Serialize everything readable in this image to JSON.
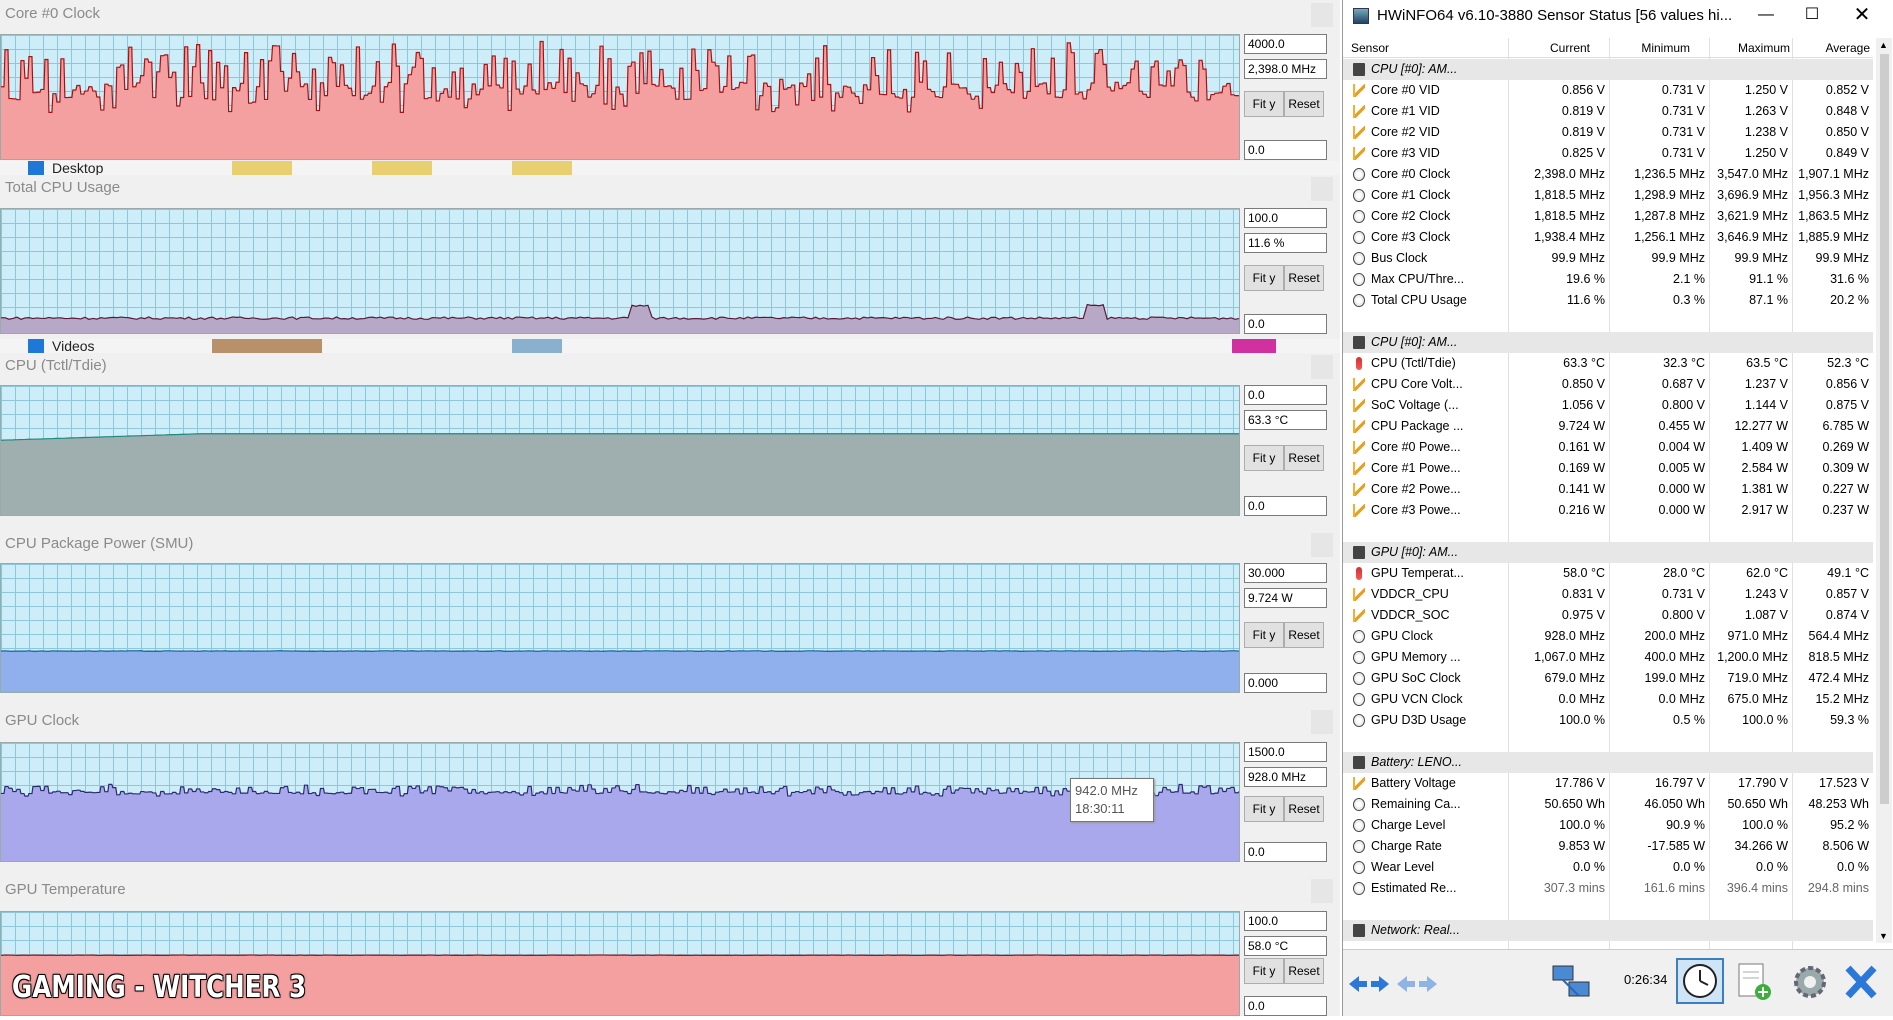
{
  "graphs": [
    {
      "title": "Core #0 Clock",
      "max": "4000.0",
      "current": "2,398.0 MHz",
      "min": "0.0",
      "fit": "Fit y",
      "reset": "Reset",
      "color": "#f4a0a0",
      "line": "#aa1010",
      "level": 0.55,
      "noise": 0.35,
      "spiky": true
    },
    {
      "title": "Total CPU Usage",
      "max": "100.0",
      "current": "11.6 %",
      "min": "0.0",
      "fit": "Fit y",
      "reset": "Reset",
      "color": "#b8a8c8",
      "line": "#5a1838",
      "level": 0.12,
      "noise": 0.05,
      "spiky": false
    },
    {
      "title": "CPU (Tctl/Tdie)",
      "max": "0.0",
      "current": "63.3 °C",
      "min": "0.0",
      "fit": "Fit y",
      "reset": "Reset",
      "color": "#9fafaf",
      "line": "#1a8a7a",
      "level": 0.63,
      "noise": 0.0,
      "spiky": false
    },
    {
      "title": "CPU Package Power (SMU)",
      "max": "30.000",
      "current": "9.724 W",
      "min": "0.000",
      "fit": "Fit y",
      "reset": "Reset",
      "color": "#8fb0ec",
      "line": "#1060a0",
      "level": 0.32,
      "noise": 0.01,
      "spiky": false
    },
    {
      "title": "GPU Clock",
      "max": "1500.0",
      "current": "928.0 MHz",
      "min": "0.0",
      "fit": "Fit y",
      "reset": "Reset",
      "color": "#aaa8ec",
      "line": "#2a2a70",
      "level": 0.58,
      "noise": 0.06,
      "spiky": true
    },
    {
      "title": "GPU Temperature",
      "max": "100.0",
      "current": "58.0 °C",
      "min": "0.0",
      "fit": "Fit y",
      "reset": "Reset",
      "color": "#f4a0a0",
      "line": "#aa1010",
      "level": 0.58,
      "noise": 0.01,
      "spiky": false
    }
  ],
  "desktop": {
    "strip1": "Desktop",
    "strip2": "Videos"
  },
  "tooltip": {
    "value": "942.0 MHz",
    "time": "18:30:11"
  },
  "overlay": "GAMING - WITCHER 3",
  "window": {
    "title": "HWiNFO64 v6.10-3880 Sensor Status [56 values hi...",
    "columns": [
      "Sensor",
      "Current",
      "Minimum",
      "Maximum",
      "Average"
    ],
    "rows": [
      {
        "t": "hdr",
        "n": "CPU [#0]: AM..."
      },
      {
        "t": "volt",
        "n": "Core #0 VID",
        "c": "0.856 V",
        "mi": "0.731 V",
        "ma": "1.250 V",
        "a": "0.852 V"
      },
      {
        "t": "volt",
        "n": "Core #1 VID",
        "c": "0.819 V",
        "mi": "0.731 V",
        "ma": "1.263 V",
        "a": "0.848 V"
      },
      {
        "t": "volt",
        "n": "Core #2 VID",
        "c": "0.819 V",
        "mi": "0.731 V",
        "ma": "1.238 V",
        "a": "0.850 V"
      },
      {
        "t": "volt",
        "n": "Core #3 VID",
        "c": "0.825 V",
        "mi": "0.731 V",
        "ma": "1.250 V",
        "a": "0.849 V"
      },
      {
        "t": "clock",
        "n": "Core #0 Clock",
        "c": "2,398.0 MHz",
        "mi": "1,236.5 MHz",
        "ma": "3,547.0 MHz",
        "a": "1,907.1 MHz"
      },
      {
        "t": "clock",
        "n": "Core #1 Clock",
        "c": "1,818.5 MHz",
        "mi": "1,298.9 MHz",
        "ma": "3,696.9 MHz",
        "a": "1,956.3 MHz"
      },
      {
        "t": "clock",
        "n": "Core #2 Clock",
        "c": "1,818.5 MHz",
        "mi": "1,287.8 MHz",
        "ma": "3,621.9 MHz",
        "a": "1,863.5 MHz"
      },
      {
        "t": "clock",
        "n": "Core #3 Clock",
        "c": "1,938.4 MHz",
        "mi": "1,256.1 MHz",
        "ma": "3,646.9 MHz",
        "a": "1,885.9 MHz"
      },
      {
        "t": "clock",
        "n": "Bus Clock",
        "c": "99.9 MHz",
        "mi": "99.9 MHz",
        "ma": "99.9 MHz",
        "a": "99.9 MHz"
      },
      {
        "t": "clock",
        "n": "Max CPU/Thre...",
        "c": "19.6 %",
        "mi": "2.1 %",
        "ma": "91.1 %",
        "a": "31.6 %"
      },
      {
        "t": "clock",
        "n": "Total CPU Usage",
        "c": "11.6 %",
        "mi": "0.3 %",
        "ma": "87.1 %",
        "a": "20.2 %"
      },
      {
        "t": "blank"
      },
      {
        "t": "hdr",
        "n": "CPU [#0]: AM..."
      },
      {
        "t": "temp",
        "n": "CPU (Tctl/Tdie)",
        "c": "63.3 °C",
        "mi": "32.3 °C",
        "ma": "63.5 °C",
        "a": "52.3 °C"
      },
      {
        "t": "volt",
        "n": "CPU Core Volt...",
        "c": "0.850 V",
        "mi": "0.687 V",
        "ma": "1.237 V",
        "a": "0.856 V"
      },
      {
        "t": "volt",
        "n": "SoC Voltage (...",
        "c": "1.056 V",
        "mi": "0.800 V",
        "ma": "1.144 V",
        "a": "0.875 V"
      },
      {
        "t": "volt",
        "n": "CPU Package ...",
        "c": "9.724 W",
        "mi": "0.455 W",
        "ma": "12.277 W",
        "a": "6.785 W"
      },
      {
        "t": "volt",
        "n": "Core #0 Powe...",
        "c": "0.161 W",
        "mi": "0.004 W",
        "ma": "1.409 W",
        "a": "0.269 W"
      },
      {
        "t": "volt",
        "n": "Core #1 Powe...",
        "c": "0.169 W",
        "mi": "0.005 W",
        "ma": "2.584 W",
        "a": "0.309 W"
      },
      {
        "t": "volt",
        "n": "Core #2 Powe...",
        "c": "0.141 W",
        "mi": "0.000 W",
        "ma": "1.381 W",
        "a": "0.227 W"
      },
      {
        "t": "volt",
        "n": "Core #3 Powe...",
        "c": "0.216 W",
        "mi": "0.000 W",
        "ma": "2.917 W",
        "a": "0.237 W"
      },
      {
        "t": "blank"
      },
      {
        "t": "hdr",
        "n": "GPU [#0]: AM..."
      },
      {
        "t": "temp",
        "n": "GPU Temperat...",
        "c": "58.0 °C",
        "mi": "28.0 °C",
        "ma": "62.0 °C",
        "a": "49.1 °C"
      },
      {
        "t": "volt",
        "n": "VDDCR_CPU",
        "c": "0.831 V",
        "mi": "0.731 V",
        "ma": "1.243 V",
        "a": "0.857 V"
      },
      {
        "t": "volt",
        "n": "VDDCR_SOC",
        "c": "0.975 V",
        "mi": "0.800 V",
        "ma": "1.087 V",
        "a": "0.874 V"
      },
      {
        "t": "clock",
        "n": "GPU Clock",
        "c": "928.0 MHz",
        "mi": "200.0 MHz",
        "ma": "971.0 MHz",
        "a": "564.4 MHz"
      },
      {
        "t": "clock",
        "n": "GPU Memory ...",
        "c": "1,067.0 MHz",
        "mi": "400.0 MHz",
        "ma": "1,200.0 MHz",
        "a": "818.5 MHz"
      },
      {
        "t": "clock",
        "n": "GPU SoC Clock",
        "c": "679.0 MHz",
        "mi": "199.0 MHz",
        "ma": "719.0 MHz",
        "a": "472.4 MHz"
      },
      {
        "t": "clock",
        "n": "GPU VCN Clock",
        "c": "0.0 MHz",
        "mi": "0.0 MHz",
        "ma": "675.0 MHz",
        "a": "15.2 MHz"
      },
      {
        "t": "clock",
        "n": "GPU D3D Usage",
        "c": "100.0 %",
        "mi": "0.5 %",
        "ma": "100.0 %",
        "a": "59.3 %"
      },
      {
        "t": "blank"
      },
      {
        "t": "hdr",
        "n": "Battery: LENO..."
      },
      {
        "t": "volt",
        "n": "Battery Voltage",
        "c": "17.786 V",
        "mi": "16.797 V",
        "ma": "17.790 V",
        "a": "17.523 V"
      },
      {
        "t": "clock",
        "n": "Remaining Ca...",
        "c": "50.650 Wh",
        "mi": "46.050 Wh",
        "ma": "50.650 Wh",
        "a": "48.253 Wh"
      },
      {
        "t": "clock",
        "n": "Charge Level",
        "c": "100.0 %",
        "mi": "90.9 %",
        "ma": "100.0 %",
        "a": "95.2 %"
      },
      {
        "t": "clock",
        "n": "Charge Rate",
        "c": "9.853 W",
        "mi": "-17.585 W",
        "ma": "34.266 W",
        "a": "8.506 W"
      },
      {
        "t": "clock",
        "n": "Wear Level",
        "c": "0.0 %",
        "mi": "0.0 %",
        "ma": "0.0 %",
        "a": "0.0 %"
      },
      {
        "t": "clock",
        "dim": true,
        "n": "Estimated Re...",
        "c": "307.3 mins",
        "mi": "161.6 mins",
        "ma": "396.4 mins",
        "a": "294.8 mins"
      },
      {
        "t": "blank"
      },
      {
        "t": "hdr",
        "n": "Network: Real..."
      }
    ],
    "timer": "0:26:34"
  }
}
